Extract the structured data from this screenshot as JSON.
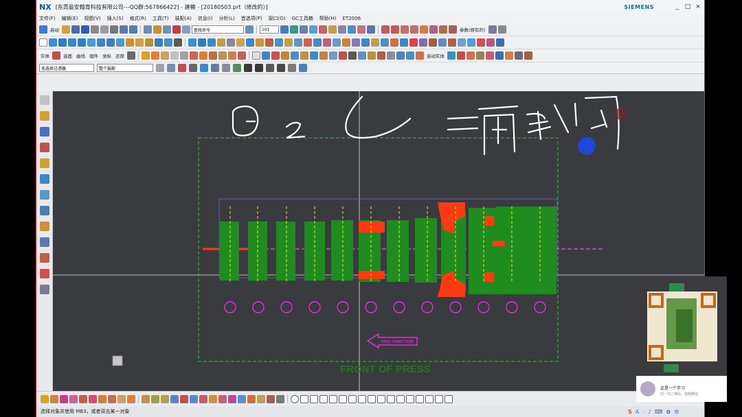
{
  "window": {
    "logo": "NX",
    "title": "[东莞盈安翰育科技有限公司---QQ群:567866422] - 建模 - [20180503.prt（修改的）]",
    "brand": "SIEMENS",
    "minimize": "_",
    "maximize": "□",
    "close": "×"
  },
  "menu": [
    "文件(F)",
    "编辑(E)",
    "视图(V)",
    "插入(S)",
    "格式(R)",
    "工具(T)",
    "装配(A)",
    "信息(I)",
    "分析(L)",
    "首选项(P)",
    "窗口(O)",
    "GC工具箱",
    "帮助(H)",
    "ET2006"
  ],
  "toolbar1": {
    "start_label": "启动",
    "command_search_placeholder": "查找命令",
    "layer_combo": "101",
    "reference_label": "参数(原有的)"
  },
  "toolbar3": {
    "labels": [
      "实体",
      "选面",
      "曲线",
      "组件",
      "坐标",
      "还原"
    ],
    "right_labels": [
      "自动实体"
    ]
  },
  "filter": {
    "type_filter": "无选择过滤器",
    "scope_filter": "整个装配"
  },
  "viewport": {
    "handwriting": "D2(L=两腔 1:1)",
    "feed_direction": "FEED DIRECTION",
    "front_of_press": "FRONT OF PRESS"
  },
  "status": {
    "message": "选择对象并使用 MB3，或者双击某一对象"
  },
  "qr_card": {
    "name": "这是一个学习",
    "subtitle": "扫一扫二维码，加我微信"
  },
  "tray": {
    "icons": [
      "S",
      "A",
      "·",
      "♪",
      "⌨",
      "✿",
      "⚙"
    ]
  },
  "colors": {
    "viewport_bg": "#3a3b3f",
    "strip_green": "#1e8c1e",
    "strip_red": "#ff3a10",
    "boundary_green": "#30c030",
    "station_magenta": "#ff2cff",
    "pilot_yellow": "#f0e030",
    "handwriting": "#ffffff",
    "cursor_blue": "#1e46d8"
  }
}
